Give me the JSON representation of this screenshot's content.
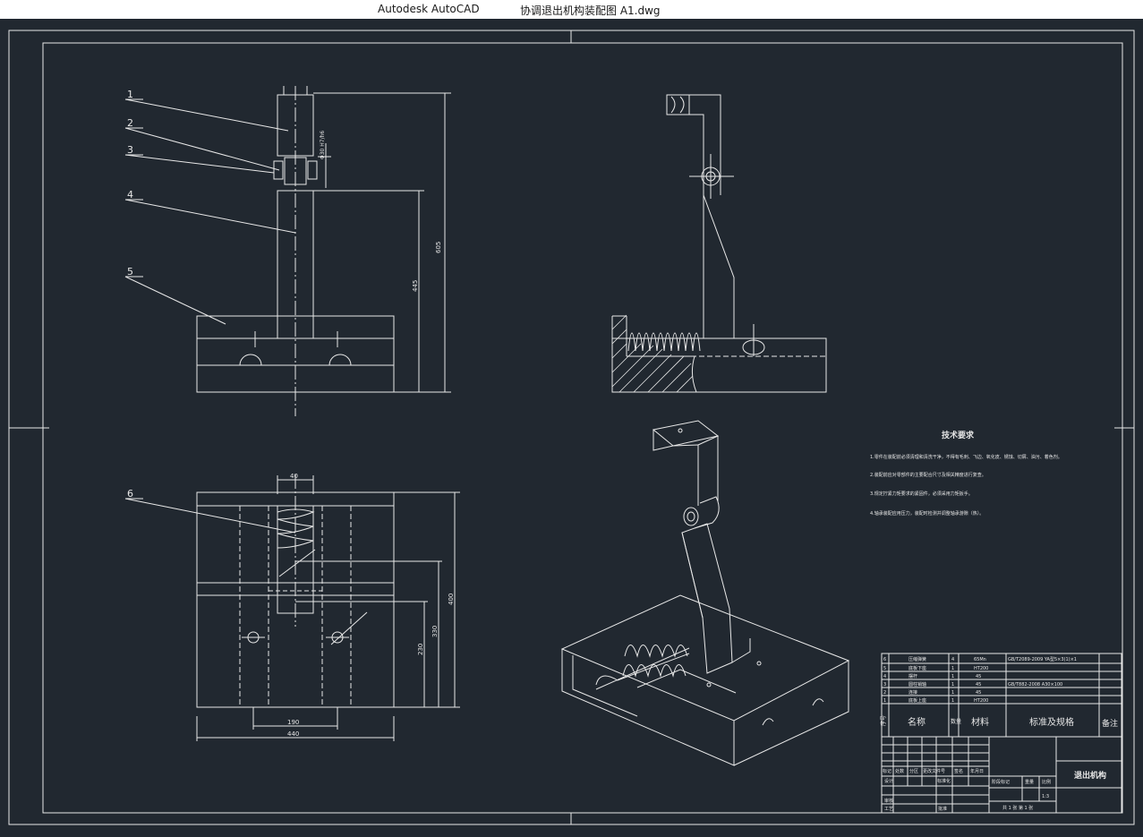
{
  "window": {
    "app_name": "Autodesk AutoCAD",
    "file_name": "协调退出机构装配图 A1.dwg"
  },
  "colors": {
    "background": "#212830",
    "line": "#e8e8e8",
    "titlebar": "#ffffff"
  },
  "balloons": [
    "1",
    "2",
    "3",
    "4",
    "5",
    "6"
  ],
  "dimensions": {
    "front_height_total": "605",
    "front_height_body": "445",
    "pin_dia": "Φ30 H7/h6",
    "top_width": "40",
    "top_height_total": "400",
    "top_h1": "330",
    "top_h2": "230",
    "top_w_inner": "190",
    "top_w_total": "440"
  },
  "tech_req": {
    "title": "技术要求",
    "items": [
      "1.零件在装配前必须清理和清洗干净，不得有毛刺、飞边、氧化皮、锈蚀、切屑、油污、着色剂。",
      "2.装配前应对零部件的主要配合尺寸及相关精度进行复查。",
      "3.规定拧紧力矩要求的紧固件，必须采用力矩扳手。",
      "4.轴承装配应用压力，装配时检测并调整轴承游隙（热）。"
    ]
  },
  "bom": {
    "rows": [
      {
        "no": "6",
        "name": "压缩弹簧",
        "qty": "4",
        "mat": "65Mn",
        "spec": "GB/T2089-2009 YA型5×3(1)×1"
      },
      {
        "no": "5",
        "name": "底板下座",
        "qty": "1",
        "mat": "HT200",
        "spec": ""
      },
      {
        "no": "4",
        "name": "摆杆",
        "qty": "1",
        "mat": "45",
        "spec": ""
      },
      {
        "no": "3",
        "name": "圆柱销轴",
        "qty": "1",
        "mat": "45",
        "spec": "GB/T882-2008 A30×100"
      },
      {
        "no": "2",
        "name": "连接",
        "qty": "1",
        "mat": "45",
        "spec": ""
      },
      {
        "no": "1",
        "name": "底板上座",
        "qty": "1",
        "mat": "HT200",
        "spec": ""
      }
    ],
    "header": {
      "no": "序号",
      "name": "名称",
      "qty": "数量",
      "mat": "材料",
      "spec": "标准及规格",
      "note": "备注"
    }
  },
  "title_block": {
    "drawing_name": "退出机构",
    "scale": "1:3",
    "labels": [
      "标记",
      "处数",
      "分区",
      "更改文件号",
      "签名",
      "年月日",
      "设计",
      "标准化",
      "阶段标记",
      "重量",
      "比例",
      "审核",
      "工艺",
      "批准"
    ],
    "sheet": "共 1 张 第 1 张"
  }
}
